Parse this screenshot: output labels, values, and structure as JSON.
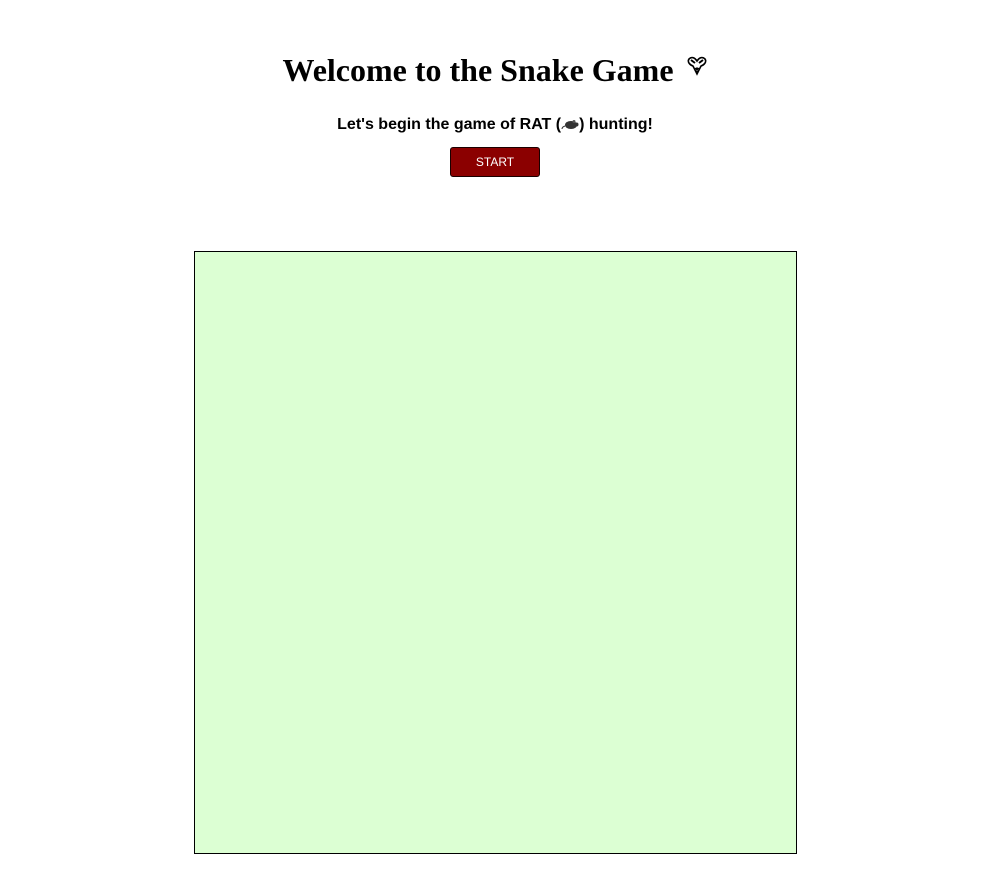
{
  "header": {
    "title": "Welcome to the Snake Game",
    "title_icon": "snake-head-icon"
  },
  "intro": {
    "text_before": "Let's begin the game of RAT (",
    "rat_icon": "rat-icon",
    "text_after": ") hunting!"
  },
  "controls": {
    "start_label": "START"
  },
  "board": {
    "icon": "game-board",
    "background_color": "#dcffd3",
    "border_color": "#000000"
  },
  "colors": {
    "start_button_bg": "#8b0000",
    "start_button_text": "#ffffff"
  }
}
